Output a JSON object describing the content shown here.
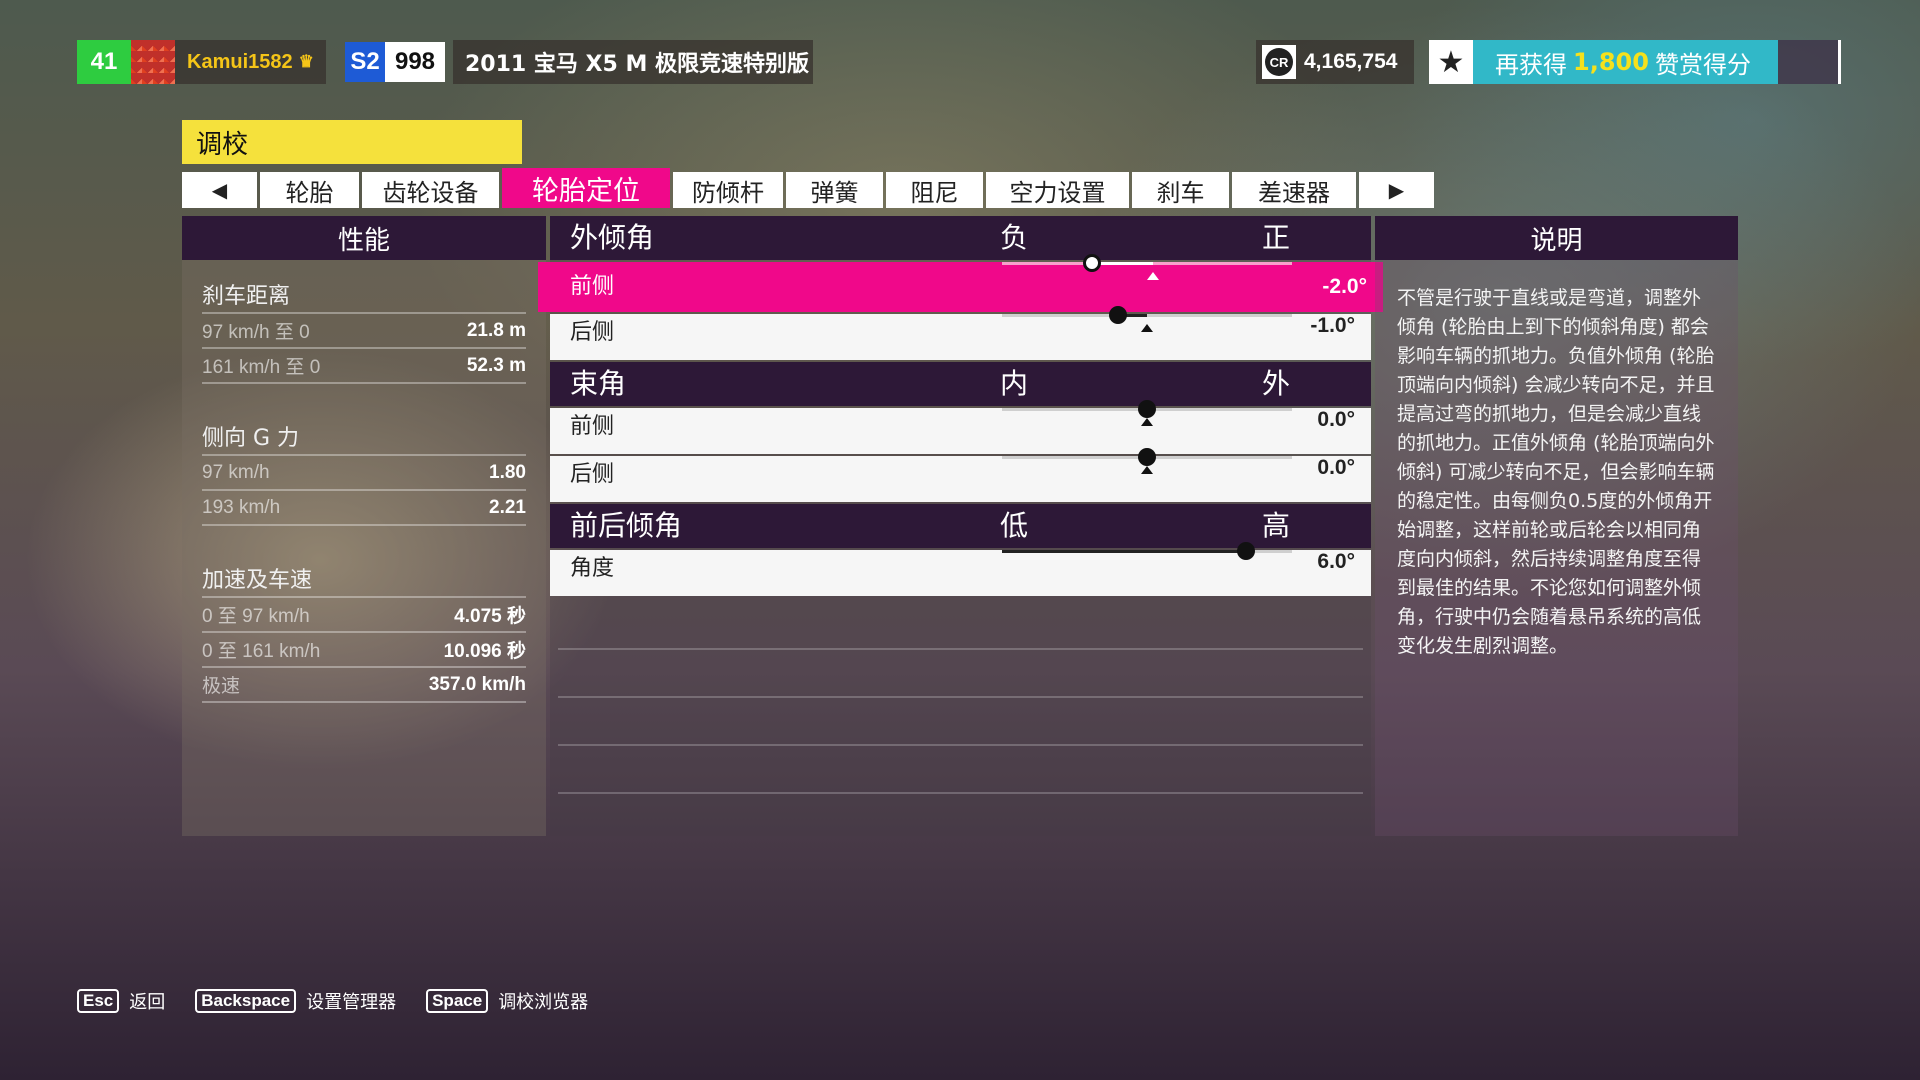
{
  "hud": {
    "level": "41",
    "gamertag": "Kamui1582",
    "crown_icon": "crown-icon",
    "car_class": "S2",
    "performance_index": "998",
    "car_name": "2011 宝马 X5 M 极限竞速特别版",
    "credits_icon_text": "CR",
    "credits": "4,165,754",
    "accolade_prefix": "再获得",
    "accolade_points": "1,800",
    "accolade_suffix": "赞赏得分",
    "accolade_progress": 0.83,
    "colors": {
      "level": "#2ecc40",
      "class": "#1e5bd6",
      "accolade": "#31b8c8",
      "highlight": "#f5e11c"
    }
  },
  "page": {
    "title": "调校",
    "accent": "#f0088a",
    "tabs": [
      {
        "label": "◀",
        "icon": "prev-tab-icon"
      },
      {
        "label": "轮胎"
      },
      {
        "label": "齿轮设备"
      },
      {
        "label": "轮胎定位",
        "active": true
      },
      {
        "label": "防倾杆"
      },
      {
        "label": "弹簧"
      },
      {
        "label": "阻尼"
      },
      {
        "label": "空力设置"
      },
      {
        "label": "刹车"
      },
      {
        "label": "差速器"
      },
      {
        "label": "▶",
        "icon": "next-tab-icon"
      }
    ]
  },
  "performance": {
    "header": "性能",
    "groups": [
      {
        "title": "刹车距离",
        "rows": [
          {
            "label": "97 km/h 至 0",
            "value": "21.8 m"
          },
          {
            "label": "161 km/h 至 0",
            "value": "52.3 m"
          }
        ]
      },
      {
        "title": "侧向 G 力",
        "rows": [
          {
            "label": "97 km/h",
            "value": "1.80"
          },
          {
            "label": "193 km/h",
            "value": "2.21"
          }
        ]
      },
      {
        "title": "加速及车速",
        "rows": [
          {
            "label": "0 至 97 km/h",
            "value": "4.075 秒"
          },
          {
            "label": "0 至 161 km/h",
            "value": "10.096 秒"
          },
          {
            "label": "极速",
            "value": "357.0 km/h"
          }
        ]
      }
    ]
  },
  "tuning": {
    "sections": [
      {
        "name": "外倾角",
        "low": "负",
        "high": "正",
        "rows": [
          {
            "label": "前侧",
            "value": "-2.0°",
            "level": 0.31,
            "default": 0.52,
            "active": true
          },
          {
            "label": "后侧",
            "value": "-1.0°",
            "level": 0.4,
            "default": 0.5
          }
        ]
      },
      {
        "name": "束角",
        "low": "内",
        "high": "外",
        "rows": [
          {
            "label": "前侧",
            "value": "0.0°",
            "level": 0.5,
            "default": 0.5
          },
          {
            "label": "后侧",
            "value": "0.0°",
            "level": 0.5,
            "default": 0.5
          }
        ]
      },
      {
        "name": "前后倾角",
        "low": "低",
        "high": "高",
        "rows": [
          {
            "label": "角度",
            "value": "6.0°",
            "level": 0.84,
            "default": null
          }
        ]
      }
    ]
  },
  "description": {
    "header": "说明",
    "text": "不管是行驶于直线或是弯道，调整外倾角 (轮胎由上到下的倾斜角度) 都会影响车辆的抓地力。负值外倾角 (轮胎顶端向内倾斜) 会减少转向不足，并且提高过弯的抓地力，但是会减少直线的抓地力。正值外倾角 (轮胎顶端向外倾斜) 可减少转向不足，但会影响车辆的稳定性。由每侧负0.5度的外倾角开始调整，这样前轮或后轮会以相同角度向内倾斜，然后持续调整角度至得到最佳的结果。不论您如何调整外倾角，行驶中仍会随着悬吊系统的高低变化发生剧烈调整。"
  },
  "footer": {
    "hints": [
      {
        "key": "Esc",
        "label": "返回"
      },
      {
        "key": "Backspace",
        "label": "设置管理器"
      },
      {
        "key": "Space",
        "label": "调校浏览器"
      }
    ]
  }
}
